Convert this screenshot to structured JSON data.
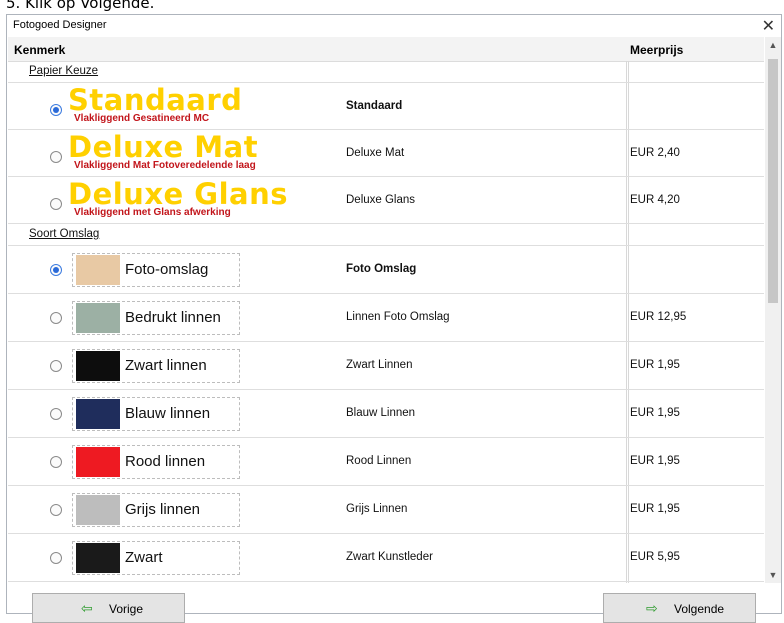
{
  "top_caption": "5. Klik op Volgende.",
  "window": {
    "title": "Fotogoed Designer",
    "close_glyph": "✕"
  },
  "header": {
    "kenmerk": "Kenmerk",
    "meerprijs": "Meerprijs"
  },
  "groups": {
    "papier": "Papier Keuze",
    "omslag": "Soort Omslag"
  },
  "paper_options": [
    {
      "name": "Standaard",
      "subtitle": "Vlakliggend Gesatineerd MC",
      "desc": "Standaard",
      "price": "",
      "selected": true
    },
    {
      "name": "Deluxe Mat",
      "subtitle": "Vlakliggend Mat Fotoveredelende laag",
      "desc": "Deluxe Mat",
      "price": "EUR 2,40",
      "selected": false
    },
    {
      "name": "Deluxe Glans",
      "subtitle": "Vlakliggend met Glans afwerking",
      "desc": "Deluxe Glans",
      "price": "EUR 4,20",
      "selected": false
    }
  ],
  "cover_options": [
    {
      "name": "Foto-omslag",
      "desc": "Foto Omslag",
      "price": "",
      "selected": true,
      "swatch_color": "#e8c9a4",
      "icon": "photo-thumbnail-icon"
    },
    {
      "name": "Bedrukt linnen",
      "desc": "Linnen Foto Omslag",
      "price": "EUR 12,95",
      "selected": false,
      "swatch_color": "#9cb0a4",
      "icon": "landscape-thumbnail-icon"
    },
    {
      "name": "Zwart linnen",
      "desc": "Zwart Linnen",
      "price": "EUR 1,95",
      "selected": false,
      "swatch_color": "#0d0d0d",
      "icon": "black-linen-swatch-icon"
    },
    {
      "name": "Blauw linnen",
      "desc": "Blauw Linnen",
      "price": "EUR 1,95",
      "selected": false,
      "swatch_color": "#1f2d5c",
      "icon": "blue-linen-swatch-icon"
    },
    {
      "name": "Rood linnen",
      "desc": "Rood Linnen",
      "price": "EUR 1,95",
      "selected": false,
      "swatch_color": "#ee1a22",
      "icon": "red-linen-swatch-icon"
    },
    {
      "name": "Grijs linnen",
      "desc": "Grijs Linnen",
      "price": "EUR 1,95",
      "selected": false,
      "swatch_color": "#bdbdbd",
      "icon": "grey-linen-swatch-icon"
    },
    {
      "name": "Zwart",
      "desc": "Zwart Kunstleder",
      "price": "EUR 5,95",
      "selected": false,
      "swatch_color": "#1a1a1a",
      "icon": "black-leather-swatch-icon"
    }
  ],
  "footer": {
    "prev_label": "Vorige",
    "next_label": "Volgende",
    "prev_arrow": "⇦",
    "next_arrow": "⇨"
  },
  "scrollbar": {
    "up": "▲",
    "down": "▼"
  },
  "colors": {
    "accent": "#2a6ad8",
    "logo_yellow": "#ffd000",
    "logo_red": "#c2151b",
    "arrow_green": "#2e9b2e"
  }
}
